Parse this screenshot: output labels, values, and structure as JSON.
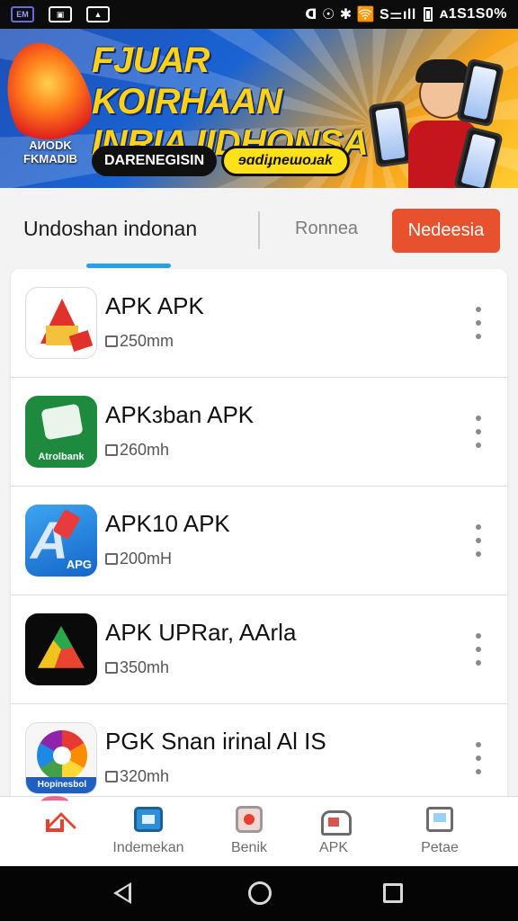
{
  "status_bar": {
    "left_badge": "EM",
    "right_text": "ꓷ ☉ ✱ 🛜 S⚌ıll",
    "battery_text": "ᴀ1S1S0%"
  },
  "banner": {
    "title_line1": "FJUAR KOIRHAAN",
    "title_line2": "INRIA IIDHONSA",
    "brand_line1": "AИODK",
    "brand_line2": "FKMADIB",
    "pill_dark": "DARENEGISIN",
    "pill_yellow": "ɘɑdiɟneɯoɹak"
  },
  "tabs": {
    "main": "Undoshan indonan",
    "second": "Ronnea",
    "button": "Nedeesia",
    "accent": "#e8512d",
    "indicator": "#27a1e6"
  },
  "apps": [
    {
      "name": "APK APK",
      "size": "250mm",
      "icon": "apk-red-icon"
    },
    {
      "name": "APKɜban APK",
      "size": "260mh",
      "icon": "apk-green-icon",
      "icon_label": "Atrolbank"
    },
    {
      "name": "APK10 APK",
      "size": "200mH",
      "icon": "apk-blue-icon",
      "icon_label": "APG"
    },
    {
      "name": "APK UPRar, AArla",
      "size": "350mh",
      "icon": "apk-triangle-icon"
    },
    {
      "name": "PGK Snan irinal Al IS",
      "size": "320mh",
      "icon": "apk-pie-icon",
      "icon_label": "Hopinesbol"
    }
  ],
  "bottom_nav": [
    {
      "label": "",
      "icon": "home-icon"
    },
    {
      "label": "Indemekan",
      "icon": "window-icon"
    },
    {
      "label": "Benik",
      "icon": "lens-icon"
    },
    {
      "label": "APK",
      "icon": "package-icon"
    },
    {
      "label": "Petae",
      "icon": "monitor-icon"
    }
  ]
}
